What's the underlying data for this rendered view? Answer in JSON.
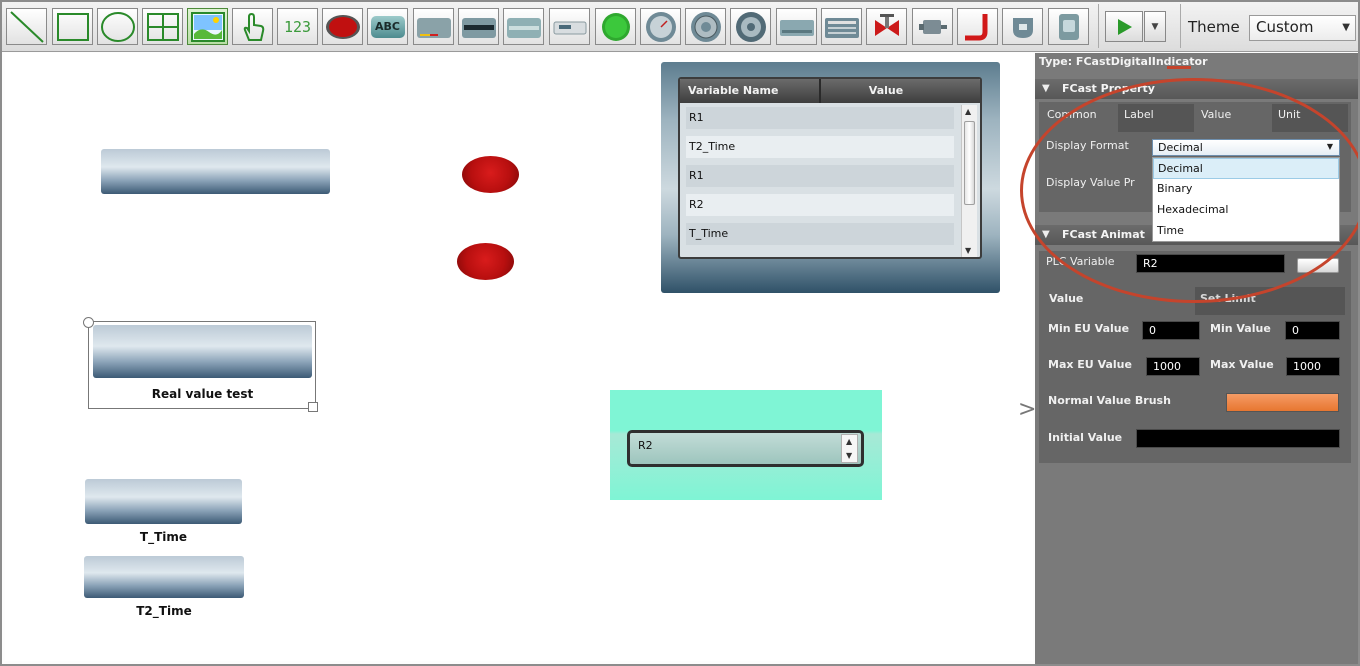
{
  "toolbar": {
    "tools": [
      {
        "name": "line-tool",
        "icon": "line-icon"
      },
      {
        "name": "rectangle-tool",
        "icon": "rectangle-icon"
      },
      {
        "name": "ellipse-tool",
        "icon": "ellipse-icon"
      },
      {
        "name": "grid-tool",
        "icon": "grid-icon"
      },
      {
        "name": "image-tool",
        "icon": "image-icon"
      },
      {
        "name": "touch-tool",
        "icon": "hand-icon"
      },
      {
        "name": "numeric-tool",
        "icon": "numeric-display-icon",
        "text": "123"
      },
      {
        "name": "red-button-tool",
        "icon": "red-button-icon"
      },
      {
        "name": "label-tool",
        "icon": "abc-label-icon",
        "text": "ABC"
      },
      {
        "name": "bar-gauge-tool",
        "icon": "bar-gauge-icon"
      },
      {
        "name": "digital-indicator-tool",
        "icon": "digital-indicator-icon"
      },
      {
        "name": "input-field-tool",
        "icon": "input-field-icon"
      },
      {
        "name": "display-panel-tool",
        "icon": "display-panel-icon"
      },
      {
        "name": "green-lamp-tool",
        "icon": "green-lamp-icon"
      },
      {
        "name": "dial-gauge-tool",
        "icon": "dial-gauge-icon"
      },
      {
        "name": "rotary-gauge-tool",
        "icon": "rotary-gauge-icon"
      },
      {
        "name": "meter-tool",
        "icon": "round-meter-icon"
      },
      {
        "name": "slider-tool",
        "icon": "slider-icon"
      },
      {
        "name": "table-panel-tool",
        "icon": "table-panel-icon"
      },
      {
        "name": "valve-tool",
        "icon": "valve-icon"
      },
      {
        "name": "motor-tool",
        "icon": "motor-icon"
      },
      {
        "name": "elbow-pipe-tool",
        "icon": "elbow-pipe-icon"
      },
      {
        "name": "tank-tool",
        "icon": "tank-icon"
      },
      {
        "name": "device-tool",
        "icon": "device-icon"
      }
    ],
    "play_icon": "play-icon",
    "dropdown_icon": "chevron-down-icon",
    "theme_label": "Theme",
    "theme_value": "Custom"
  },
  "canvas": {
    "selected_label": "Real value test",
    "label_t_time": "T_Time",
    "label_t2_time": "T2_Time",
    "variable_table": {
      "headers": [
        "Variable Name",
        "Value"
      ],
      "rows": [
        "R1",
        "T2_Time",
        "R1",
        "R2",
        "T_Time"
      ]
    },
    "teal_value": "R2",
    "expand_icon": "chevron-right-icon"
  },
  "panel": {
    "type_line": "Type: FCastDigitalIndicator",
    "property_header": "FCast Property",
    "tabs": [
      "Common",
      "Label",
      "Value",
      "Unit"
    ],
    "display_format_label": "Display Format",
    "display_format_value": "Decimal",
    "display_value_label": "Display Value Pr",
    "format_options": [
      "Decimal",
      "Binary",
      "Hexadecimal",
      "Time"
    ],
    "animation_header": "FCast Animat",
    "plc_variable_label": "PLC Variable",
    "plc_variable_value": "R2",
    "value_tab": "Value",
    "set_limit_tab": "Set Limit",
    "min_eu_label": "Min EU Value",
    "min_eu_value": "0",
    "min_value_label": "Min Value",
    "min_value": "0",
    "max_eu_label": "Max EU Value",
    "max_eu_value": "1000",
    "max_value_label": "Max Value",
    "max_value": "1000",
    "normal_brush_label": "Normal Value Brush",
    "initial_value_label": "Initial Value",
    "initial_value": ""
  },
  "colors": {
    "annotation": "#c5442c",
    "teal_widget": "#7ff5d5",
    "brush": "#e77630"
  }
}
